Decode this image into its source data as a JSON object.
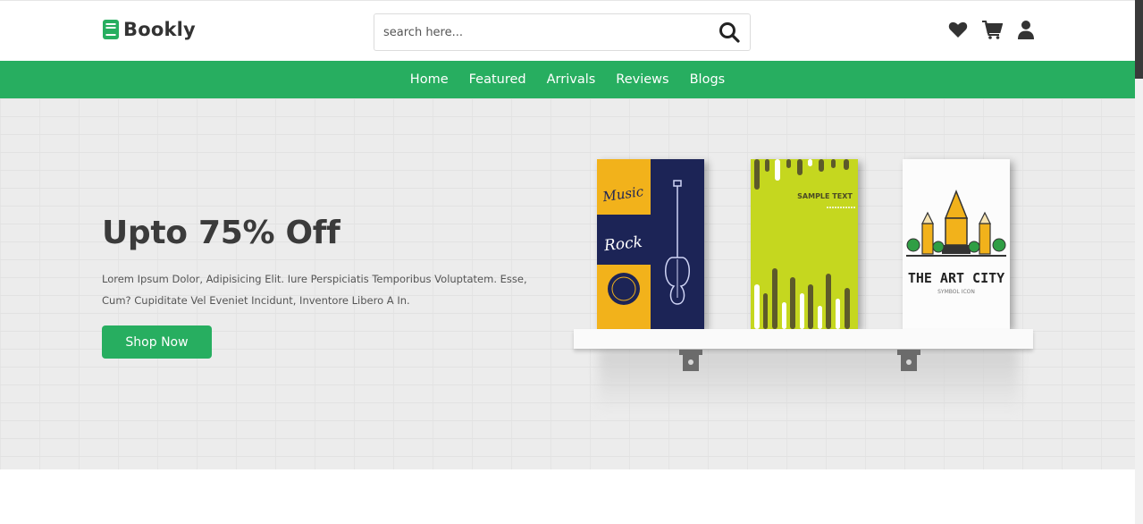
{
  "brand": {
    "name": "Bookly",
    "accent": "#27ae60"
  },
  "search": {
    "placeholder": "search here...",
    "icon": "search-icon"
  },
  "header_icons": [
    "heart-icon",
    "cart-icon",
    "user-icon"
  ],
  "nav": {
    "links": [
      "Home",
      "Featured",
      "Arrivals",
      "Reviews",
      "Blogs"
    ]
  },
  "hero": {
    "title": "Upto 75% Off",
    "description": "Lorem Ipsum Dolor, Adipisicing Elit. Iure Perspiciatis Temporibus Voluptatem. Esse, Cum? Cupiditate Vel Eveniet Incidunt, Inventore Libero A In.",
    "button_label": "Shop Now"
  },
  "books": [
    {
      "lines": [
        "Music",
        "Rock"
      ]
    },
    {
      "lines": [
        "SAMPLE TEXT"
      ]
    },
    {
      "lines": [
        "THE ART CITY",
        "SYMBOL ICON"
      ]
    }
  ]
}
